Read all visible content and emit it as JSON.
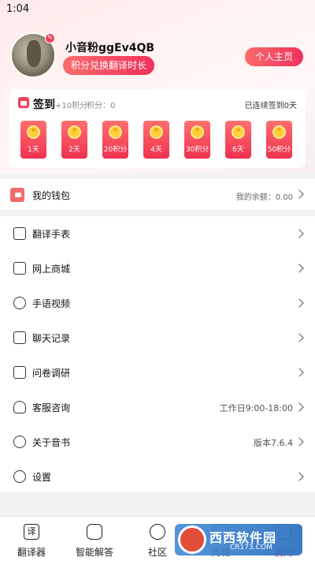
{
  "status_bar": {
    "time": "1:04"
  },
  "profile": {
    "username": "小音粉ggEv4QB",
    "points_pill": "积分兑换翻译时长",
    "profile_button": "个人主页"
  },
  "signin": {
    "title": "签到",
    "plus_points": "+10积分",
    "points": "积分：0",
    "streak": "已连续签到0天",
    "days": [
      {
        "label": "1天"
      },
      {
        "label": "2天"
      },
      {
        "label": "20积分"
      },
      {
        "label": "4天"
      },
      {
        "label": "30积分"
      },
      {
        "label": "6天"
      },
      {
        "label": "50积分"
      }
    ]
  },
  "wallet": {
    "label": "我的钱包",
    "balance": "我的余额：0.00"
  },
  "menu": [
    {
      "label": "翻译手表",
      "value": "",
      "icon": "watch-icon"
    },
    {
      "label": "网上商城",
      "value": "",
      "icon": "store-icon"
    },
    {
      "label": "手语视频",
      "value": "",
      "icon": "video-icon"
    },
    {
      "label": "聊天记录",
      "value": "",
      "icon": "chat-icon"
    },
    {
      "label": "问卷调研",
      "value": "",
      "icon": "survey-icon"
    },
    {
      "label": "客服咨询",
      "value": "工作日9:00-18:00",
      "icon": "headset-icon"
    },
    {
      "label": "关于音书",
      "value": "版本7.6.4",
      "icon": "info-icon"
    },
    {
      "label": "设置",
      "value": "",
      "icon": "gear-icon"
    }
  ],
  "bottom_nav": [
    {
      "label": "翻译器",
      "icon": "translator-icon",
      "glyph": "译"
    },
    {
      "label": "智能解答",
      "icon": "robot-icon",
      "glyph": ""
    },
    {
      "label": "社区",
      "icon": "community-icon",
      "glyph": ""
    },
    {
      "label": "商城",
      "icon": "shop-icon",
      "glyph": ""
    },
    {
      "label": "我的",
      "icon": "profile-icon",
      "glyph": ""
    }
  ],
  "watermark": {
    "text": "西西软件园",
    "sub": "CR173.COM"
  },
  "colors": {
    "accent": "#f0315c",
    "accent_light": "#fb6b6b",
    "coin": "#ffcf3c"
  }
}
